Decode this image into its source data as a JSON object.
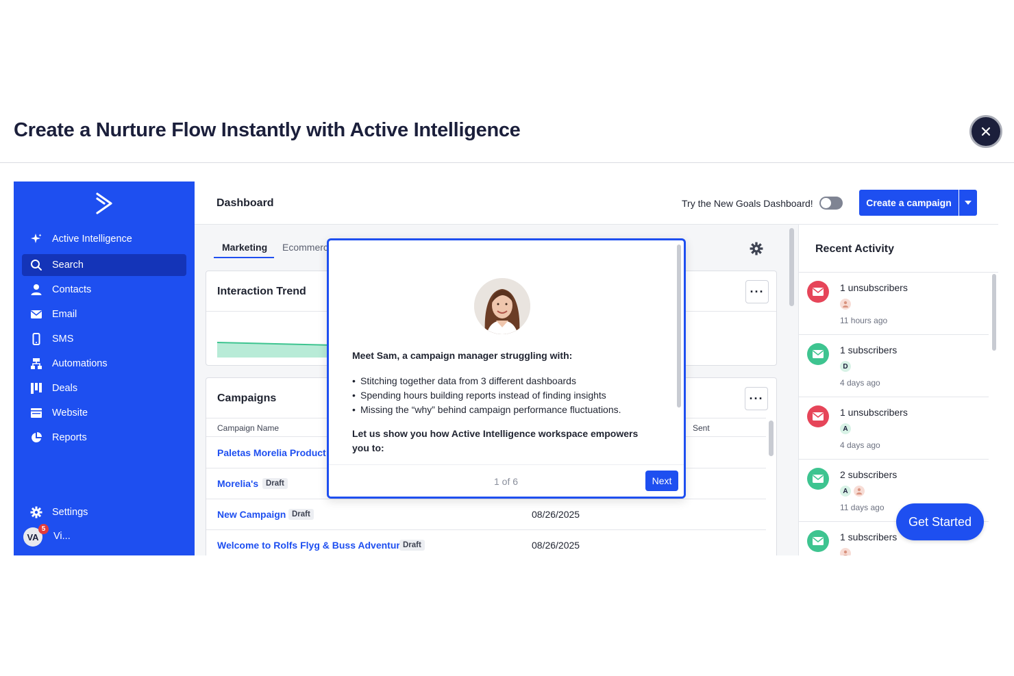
{
  "header": {
    "title": "Create a Nurture Flow Instantly with Active Intelligence",
    "close_label": "×"
  },
  "sidebar": {
    "items": [
      {
        "label": "Active Intelligence",
        "icon": "sparkle-icon"
      },
      {
        "label": "Search",
        "icon": "search-icon"
      },
      {
        "label": "Contacts",
        "icon": "person-icon"
      },
      {
        "label": "Email",
        "icon": "envelope-icon"
      },
      {
        "label": "SMS",
        "icon": "phone-icon"
      },
      {
        "label": "Automations",
        "icon": "automation-icon"
      },
      {
        "label": "Deals",
        "icon": "deals-icon"
      },
      {
        "label": "Website",
        "icon": "website-icon"
      },
      {
        "label": "Reports",
        "icon": "pie-chart-icon"
      },
      {
        "label": "Settings",
        "icon": "gear-icon"
      }
    ],
    "user": {
      "initials": "VA",
      "badge": "5",
      "name": "Vi..."
    }
  },
  "topbar": {
    "title": "Dashboard",
    "goals_label": "Try the New Goals Dashboard!",
    "create_label": "Create a campaign"
  },
  "tabs": [
    {
      "label": "Marketing"
    },
    {
      "label": "Ecommerce"
    }
  ],
  "trend": {
    "title": "Interaction Trend"
  },
  "campaigns": {
    "title": "Campaigns",
    "col_name": "Campaign Name",
    "col_sent": "Sent",
    "rows": [
      {
        "name": "Paletas Morelia Product L",
        "badge": "",
        "date": ""
      },
      {
        "name": "Morelia's",
        "badge": "Draft",
        "date": ""
      },
      {
        "name": "New Campaign",
        "badge": "Draft",
        "date": "08/26/2025"
      },
      {
        "name": "Welcome to Rolfs Flyg & Buss Adventure",
        "badge": "Draft",
        "date": "08/26/2025"
      }
    ]
  },
  "activity": {
    "title": "Recent Activity",
    "items": [
      {
        "text": "1 unsubscribers",
        "time": "11 hours ago",
        "avatars": [
          ""
        ],
        "color": "red"
      },
      {
        "text": "1 subscribers",
        "time": "4 days ago",
        "avatars": [
          "D"
        ],
        "color": "green"
      },
      {
        "text": "1 unsubscribers",
        "time": "4 days ago",
        "avatars": [
          "A"
        ],
        "color": "red"
      },
      {
        "text": "2 subscribers",
        "time": "11 days ago",
        "avatars": [
          "A",
          ""
        ],
        "color": "green"
      },
      {
        "text": "1 subscribers",
        "time": "",
        "avatars": [
          ""
        ],
        "color": "green"
      }
    ]
  },
  "modal": {
    "intro": "Meet Sam, a campaign manager struggling with:",
    "points": [
      "Stitching together data from 3 different dashboards",
      "Spending hours building reports instead of finding insights",
      "Missing the “why” behind campaign performance fluctuations."
    ],
    "cta": "Let us show you how Active Intelligence workspace empowers you to:",
    "page": "1 of 6",
    "next_label": "Next"
  },
  "get_started_label": "Get Started",
  "colors": {
    "brand": "#1e4ff0",
    "sidebar_active": "#1434b8",
    "red": "#e64559",
    "green": "#3ec490",
    "dark": "#1b1f3b"
  }
}
